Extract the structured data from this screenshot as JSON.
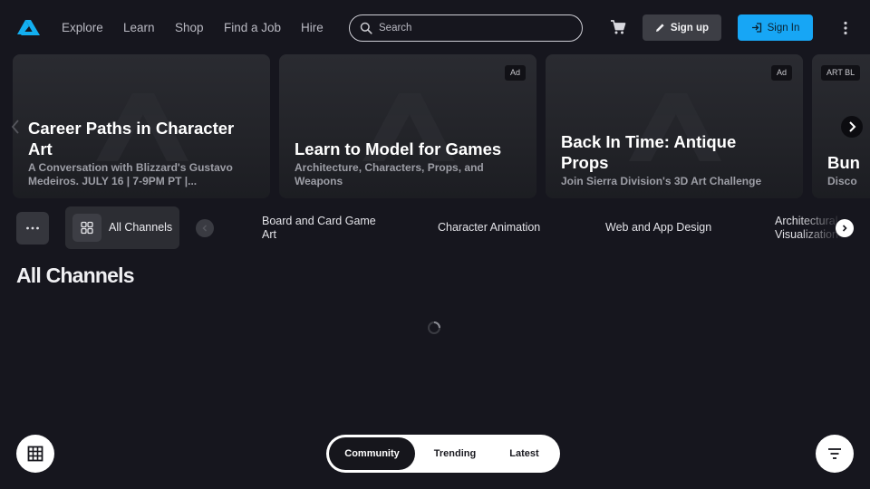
{
  "nav": {
    "links": [
      "Explore",
      "Learn",
      "Shop",
      "Find a Job",
      "Hire"
    ],
    "search_placeholder": "Search",
    "signup_label": "Sign up",
    "signin_label": "Sign In"
  },
  "carousel": {
    "cards": [
      {
        "title": "Career Paths in Character Art",
        "subtitle": "A Conversation with Blizzard's Gustavo Medeiros. JULY 16 | 7-9PM PT |...",
        "ad": ""
      },
      {
        "title": "Learn to Model for Games",
        "subtitle": "Architecture, Characters, Props, and Weapons",
        "ad": "Ad"
      },
      {
        "title": "Back In Time: Antique Props",
        "subtitle": "Join Sierra Division's 3D Art Challenge",
        "ad": "Ad"
      },
      {
        "title": "Bun",
        "subtitle": "Disco",
        "ad": "ART BL"
      }
    ]
  },
  "channels": {
    "all_label": "All Channels",
    "items": [
      "Board and Card Game Art",
      "Character Animation",
      "Web and App Design",
      "Architectural Visualization"
    ]
  },
  "main": {
    "heading": "All Channels"
  },
  "feed_tabs": {
    "items": [
      "Community",
      "Trending",
      "Latest"
    ],
    "active": "Community"
  },
  "colors": {
    "background": "#16161e",
    "brand_blue": "#17a6f5",
    "card": "#26272c"
  }
}
